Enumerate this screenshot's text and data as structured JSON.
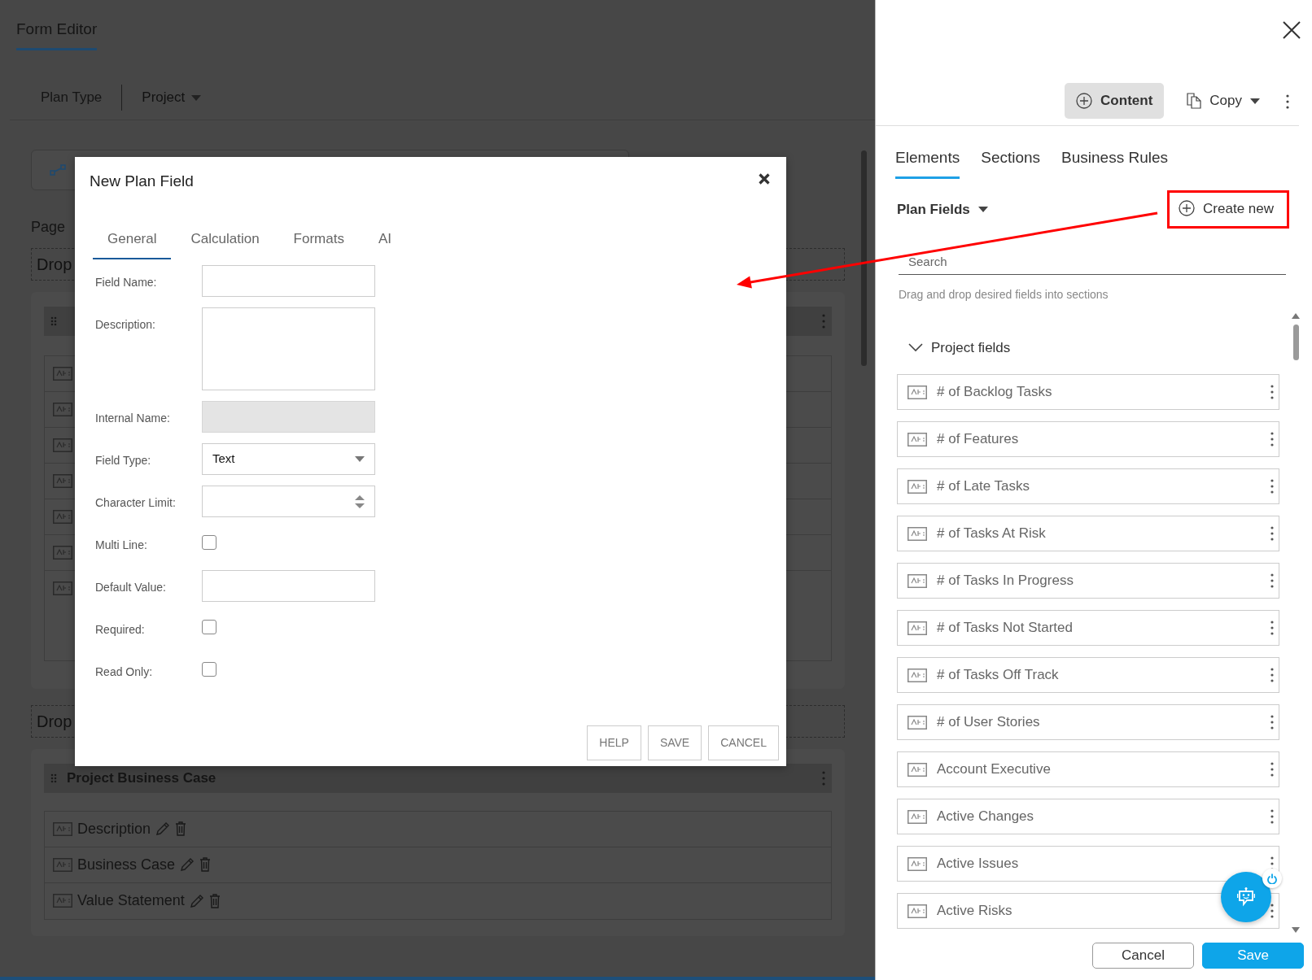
{
  "background": {
    "tab": {
      "label": "Form Editor",
      "selected": true
    },
    "plan_type_label": "Plan Type",
    "plan_type_value": "Project",
    "page_heading": "Page",
    "drop_zones": [
      "Drop",
      "Drop"
    ],
    "hidden_section": {
      "rows": [
        {
          "kind": "text"
        },
        {
          "kind": "text"
        },
        {
          "kind": "text"
        },
        {
          "kind": "text"
        },
        {
          "kind": "text"
        },
        {
          "kind": "text"
        },
        {
          "kind": "text"
        }
      ]
    },
    "business_case_section": {
      "title": "Project Business Case",
      "rows": [
        {
          "label": "Description",
          "kind": "text"
        },
        {
          "label": "Business Case",
          "kind": "text"
        },
        {
          "label": "Value Statement",
          "kind": "text"
        }
      ]
    }
  },
  "dialog": {
    "title": "New Plan Field",
    "tabs": [
      {
        "label": "General",
        "selected": true
      },
      {
        "label": "Calculation",
        "selected": false
      },
      {
        "label": "Formats",
        "selected": false
      },
      {
        "label": "AI",
        "selected": false
      }
    ],
    "fields": [
      {
        "label": "Field Name:",
        "kind": "text",
        "disabled": false
      },
      {
        "label": "Description:",
        "kind": "textarea",
        "disabled": false
      },
      {
        "label": "Internal Name:",
        "kind": "text",
        "disabled": true
      },
      {
        "label": "Field Type:",
        "kind": "select",
        "value": "Text",
        "disabled": false
      },
      {
        "label": "Character Limit:",
        "kind": "number",
        "disabled": false
      },
      {
        "label": "Multi Line:",
        "kind": "checkbox",
        "checked": false,
        "disabled": false
      },
      {
        "label": "Default Value:",
        "kind": "text",
        "disabled": false
      },
      {
        "label": "Required:",
        "kind": "checkbox",
        "checked": false,
        "disabled": false
      },
      {
        "label": "Read Only:",
        "kind": "checkbox",
        "checked": false,
        "disabled": false
      }
    ],
    "buttons": [
      "HELP",
      "SAVE",
      "CANCEL"
    ]
  },
  "panel": {
    "toolbar": [
      {
        "label": "Content",
        "kind": "add",
        "selected": true
      },
      {
        "label": "Copy",
        "kind": "copy-menu",
        "selected": false
      }
    ],
    "tabs": [
      {
        "label": "Elements",
        "selected": true
      },
      {
        "label": "Sections",
        "selected": false
      },
      {
        "label": "Business Rules",
        "selected": false
      }
    ],
    "field_source": "Plan Fields",
    "create_button": "Create new",
    "search": {
      "placeholder": "Search"
    },
    "hint": "Drag and drop desired fields into sections",
    "group": {
      "label": "Project fields",
      "expanded": true,
      "items": [
        {
          "label": "# of Backlog Tasks"
        },
        {
          "label": "# of Features"
        },
        {
          "label": "# of Late Tasks"
        },
        {
          "label": "# of Tasks At Risk"
        },
        {
          "label": "# of Tasks In Progress"
        },
        {
          "label": "# of Tasks Not Started"
        },
        {
          "label": "# of Tasks Off Track"
        },
        {
          "label": "# of User Stories"
        },
        {
          "label": "Account Executive"
        },
        {
          "label": "Active Changes"
        },
        {
          "label": "Active Issues"
        },
        {
          "label": "Active Risks"
        }
      ]
    },
    "footer_buttons": [
      {
        "label": "Cancel",
        "kind": "secondary"
      },
      {
        "label": "Save",
        "kind": "primary"
      }
    ]
  }
}
